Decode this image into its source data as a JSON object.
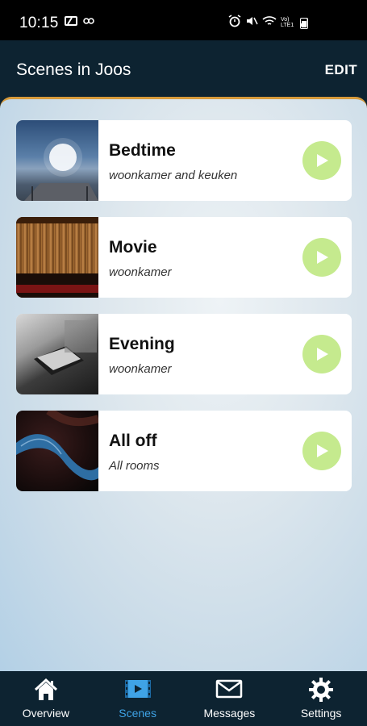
{
  "status_bar": {
    "time": "10:15"
  },
  "header": {
    "title": "Scenes in Joos",
    "edit_label": "EDIT"
  },
  "scenes": [
    {
      "name": "Bedtime",
      "rooms": "woonkamer and keuken"
    },
    {
      "name": "Movie",
      "rooms": "woonkamer"
    },
    {
      "name": "Evening",
      "rooms": "woonkamer"
    },
    {
      "name": "All off",
      "rooms": "All rooms"
    }
  ],
  "nav": [
    {
      "label": "Overview",
      "icon": "home-icon"
    },
    {
      "label": "Scenes",
      "icon": "scenes-icon",
      "active": true
    },
    {
      "label": "Messages",
      "icon": "envelope-icon"
    },
    {
      "label": "Settings",
      "icon": "gear-icon"
    }
  ],
  "colors": {
    "header_bg": "#0d2331",
    "accent": "#3fa3e6",
    "play_button": "#c5ea8e",
    "divider": "#d79b3c"
  }
}
